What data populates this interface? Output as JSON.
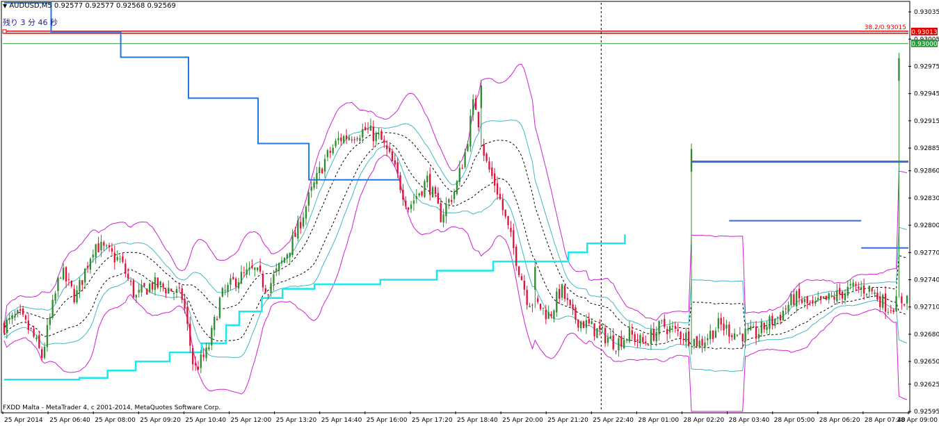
{
  "header": {
    "symbol_line": "AUDUSD,M5  0.92577 0.92577 0.92568 0.92569",
    "countdown": "残り 3 分 46 秒"
  },
  "footer": {
    "copyright": "FXDD Malta - MetaTrader 4, c 2001-2014, MetaQuotes Software Corp."
  },
  "annotations": {
    "fib_label": "38.2/0.93015",
    "fib_price_tag": "0.93013",
    "level_price_tag": "0.93000"
  },
  "colors": {
    "background": "#ffffff",
    "bull": "#2e8b2e",
    "bear": "#e0103a",
    "outer_band": "#d020d0",
    "inner_band": "#3fb8c0",
    "stair_blue": "#1e78e0",
    "stair_cyan": "#18e8f0",
    "fib_red": "#e00000",
    "level_green": "#2a9a3a",
    "box_blue": "#3a68d8"
  },
  "chart_data": {
    "type": "candlestick",
    "symbol": "AUDUSD",
    "timeframe": "M5",
    "ylim": [
      0.92595,
      0.93045
    ],
    "y_ticks": [
      "0.93035",
      "0.93005",
      "0.92975",
      "0.92945",
      "0.92915",
      "0.92885",
      "0.92860",
      "0.92830",
      "0.92800",
      "0.92770",
      "0.92740",
      "0.92710",
      "0.92680",
      "0.92650",
      "0.92625",
      "0.92595"
    ],
    "x_ticks": [
      "25 Apr 2014",
      "25 Apr 06:40",
      "25 Apr 08:00",
      "25 Apr 09:20",
      "25 Apr 10:40",
      "25 Apr 12:00",
      "25 Apr 13:20",
      "25 Apr 14:40",
      "25 Apr 16:00",
      "25 Apr 17:20",
      "25 Apr 18:40",
      "25 Apr 20:00",
      "25 Apr 21:20",
      "25 Apr 22:40",
      "28 Apr 01:00",
      "28 Apr 02:20",
      "28 Apr 03:40",
      "28 Apr 05:00",
      "28 Apr 06:20",
      "28 Apr 07:40",
      "28 Apr 09:00"
    ],
    "session_separator_index": 13,
    "bar_count": 336,
    "close_anchors": [
      [
        0,
        0.9269
      ],
      [
        8,
        0.927
      ],
      [
        15,
        0.9268
      ],
      [
        20,
        0.92655
      ],
      [
        30,
        0.9275
      ],
      [
        38,
        0.9272
      ],
      [
        48,
        0.9278
      ],
      [
        55,
        0.9277
      ],
      [
        62,
        0.9276
      ],
      [
        70,
        0.9272
      ],
      [
        78,
        0.92735
      ],
      [
        88,
        0.9273
      ],
      [
        95,
        0.9272
      ],
      [
        101,
        0.9264
      ],
      [
        108,
        0.9266
      ],
      [
        115,
        0.9272
      ],
      [
        123,
        0.9274
      ],
      [
        133,
        0.9275
      ],
      [
        140,
        0.9273
      ],
      [
        148,
        0.9276
      ],
      [
        155,
        0.9279
      ],
      [
        162,
        0.9283
      ],
      [
        170,
        0.9287
      ],
      [
        178,
        0.92895
      ],
      [
        185,
        0.929
      ],
      [
        192,
        0.92905
      ],
      [
        200,
        0.92895
      ],
      [
        206,
        0.9287
      ],
      [
        215,
        0.9282
      ],
      [
        225,
        0.9285
      ],
      [
        232,
        0.9281
      ],
      [
        240,
        0.9284
      ],
      [
        245,
        0.9288
      ],
      [
        250,
        0.9294
      ],
      [
        256,
        0.9287
      ],
      [
        262,
        0.9284
      ],
      [
        270,
        0.9278
      ],
      [
        278,
        0.9272
      ],
      [
        285,
        0.9271
      ],
      [
        290,
        0.927
      ],
      [
        296,
        0.9273
      ],
      [
        302,
        0.927
      ],
      [
        310,
        0.9269
      ],
      [
        318,
        0.9268
      ],
      [
        325,
        0.9267
      ],
      [
        332,
        0.9268
      ],
      [
        340,
        0.9267
      ],
      [
        350,
        0.9269
      ],
      [
        360,
        0.9268
      ],
      [
        370,
        0.9267
      ],
      [
        380,
        0.9269
      ],
      [
        390,
        0.9268
      ],
      [
        400,
        0.9268
      ],
      [
        405,
        0.9269
      ],
      [
        412,
        0.927
      ],
      [
        420,
        0.9272
      ],
      [
        430,
        0.9271
      ],
      [
        440,
        0.9272
      ],
      [
        450,
        0.9273
      ],
      [
        460,
        0.9273
      ],
      [
        470,
        0.9271
      ],
      [
        480,
        0.9272
      ]
    ],
    "notable_bars": [
      {
        "note": "spike high after session gap",
        "price": 0.9276
      },
      {
        "note": "spike high near 25 Apr 16:00",
        "price": 0.9296
      },
      {
        "note": "spike high near 28 Apr 02:20",
        "price": 0.9289
      },
      {
        "note": "rally high near 28 Apr 09:00",
        "price": 0.9299
      }
    ],
    "bollinger": {
      "period": 20,
      "inner_k": 1,
      "outer_k": 2
    },
    "horizontal_levels": [
      {
        "name": "fib_38_2",
        "price": 0.93013
      },
      {
        "name": "level_0_93000",
        "price": 0.93
      },
      {
        "name": "box_top",
        "price": 0.9287
      },
      {
        "name": "box_mid",
        "price": 0.92805
      },
      {
        "name": "box_bottom",
        "price": 0.92775
      }
    ],
    "blue_stair": [
      [
        0,
        0.93045
      ],
      [
        25,
        0.93013
      ],
      [
        62,
        0.92985
      ],
      [
        98,
        0.9294
      ],
      [
        135,
        0.9289
      ],
      [
        162,
        0.9285
      ],
      [
        198,
        0.9285
      ],
      [
        210,
        0.9285
      ]
    ],
    "cyan_stair": [
      [
        0,
        0.9263
      ],
      [
        20,
        0.9263
      ],
      [
        40,
        0.92632
      ],
      [
        55,
        0.9264
      ],
      [
        70,
        0.9265
      ],
      [
        88,
        0.9266
      ],
      [
        105,
        0.9267
      ],
      [
        118,
        0.9269
      ],
      [
        125,
        0.92705
      ],
      [
        137,
        0.9272
      ],
      [
        148,
        0.9273
      ],
      [
        165,
        0.92735
      ],
      [
        200,
        0.9274
      ],
      [
        230,
        0.9275
      ],
      [
        260,
        0.9276
      ],
      [
        300,
        0.9277
      ],
      [
        310,
        0.9278
      ],
      [
        330,
        0.9279
      ]
    ]
  }
}
